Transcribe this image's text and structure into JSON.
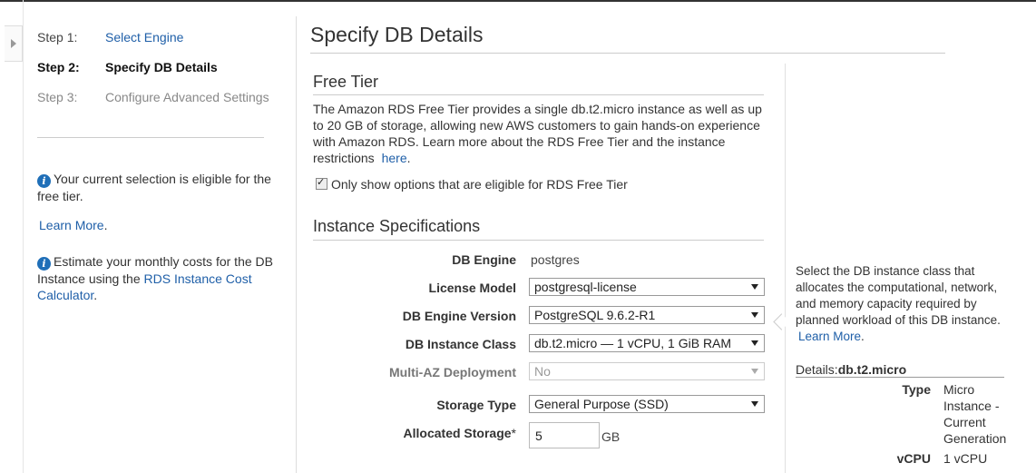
{
  "wizard": {
    "steps": [
      {
        "num": "Step 1:",
        "label": "Select Engine"
      },
      {
        "num": "Step 2:",
        "label": "Specify DB Details"
      },
      {
        "num": "Step 3:",
        "label": "Configure Advanced Settings"
      }
    ]
  },
  "sidebar": {
    "note1": "Your current selection is eligible for the free tier.",
    "learn_more": "Learn More",
    "note2_prefix": "Estimate your monthly costs for the DB Instance using the",
    "calc_link": "RDS Instance Cost Calculator",
    "dot": "."
  },
  "page": {
    "title": "Specify DB Details"
  },
  "free_tier": {
    "title": "Free Tier",
    "text": "The Amazon RDS Free Tier provides a single db.t2.micro instance as well as up to 20 GB of storage, allowing new AWS customers to gain hands-on experience with Amazon RDS. Learn more about the RDS Free Tier and the instance restrictions",
    "here_link": "here",
    "checkbox_label": "Only show options that are eligible for RDS Free Tier"
  },
  "instance": {
    "title": "Instance Specifications",
    "db_engine_label": "DB Engine",
    "db_engine_value": "postgres",
    "license_label": "License Model",
    "license_value": "postgresql-license",
    "version_label": "DB Engine Version",
    "version_value": "PostgreSQL 9.6.2-R1",
    "class_label": "DB Instance Class",
    "class_value": "db.t2.micro — 1 vCPU, 1 GiB RAM",
    "multiaz_label": "Multi-AZ Deployment",
    "multiaz_value": "No",
    "storage_type_label": "Storage Type",
    "storage_type_value": "General Purpose (SSD)",
    "allocated_label": "Allocated Storage",
    "required_mark": "*",
    "allocated_value": "5",
    "allocated_unit": "GB"
  },
  "help": {
    "text": "Select the DB instance class that allocates the computational, network, and memory capacity required by planned workload of this DB instance.",
    "learn_more": "Learn More",
    "details_prefix": "Details:",
    "details_class": "db.t2.micro",
    "type_label": "Type",
    "type_value": "Micro Instance - Current Generation",
    "vcpu_label": "vCPU",
    "vcpu_value": "1 vCPU"
  }
}
